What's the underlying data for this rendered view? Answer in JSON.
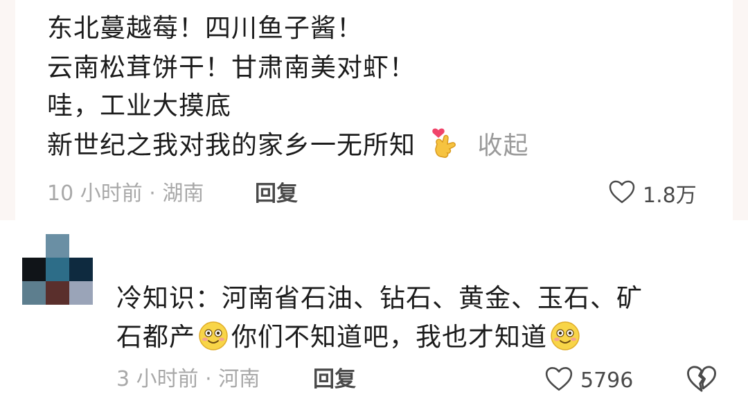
{
  "comment1": {
    "lines": [
      "东北蔓越莓！四川鱼子酱！",
      "云南松茸饼干！甘肃南美对虾！",
      "哇，工业大摸底",
      "新世纪之我对我的家乡一无所知"
    ],
    "collapse_label": "收起",
    "time_location": "10 小时前 · 湖南",
    "reply_label": "回复",
    "like_count": "1.8万",
    "emoji_icon": "heart-hands-icon"
  },
  "comment2": {
    "line1": "冷知识：河南省石油、钻石、黄金、玉石、矿",
    "line2_part1": "石都产",
    "line2_part2": "你们不知道吧，我也才知道",
    "time_location": "3 小时前 · 河南",
    "reply_label": "回复",
    "like_count": "5796",
    "emoji_icon": "smile-emoji-icon"
  }
}
